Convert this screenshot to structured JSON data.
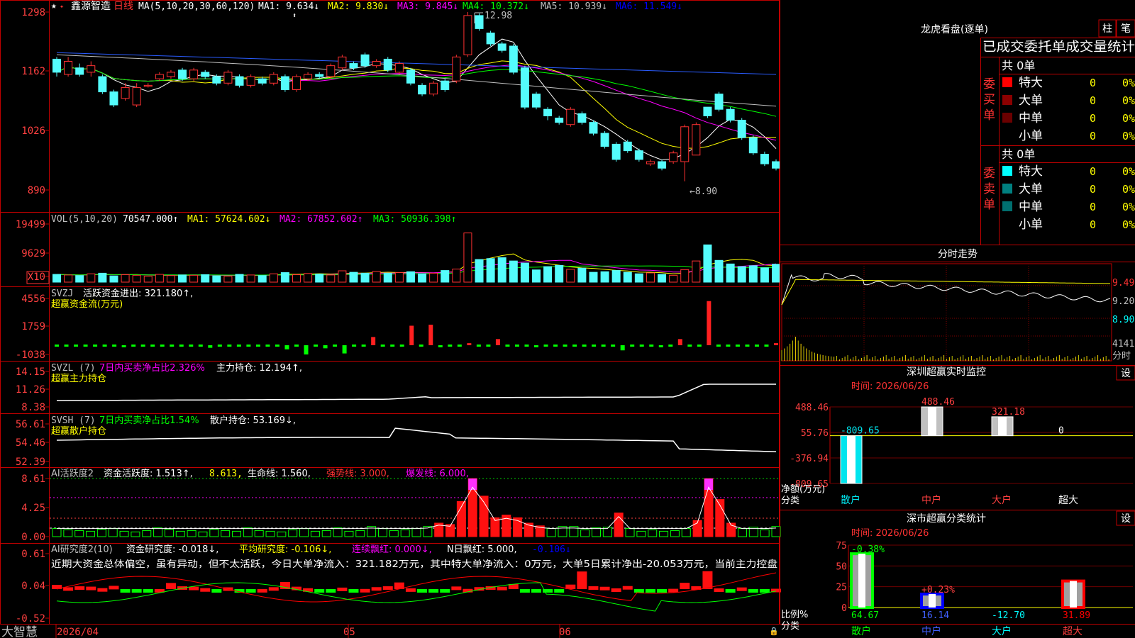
{
  "stock": {
    "name": "鑫源智造",
    "period": "日线",
    "star_icon": "star-icon"
  },
  "candles": {
    "ma_label": "MA(5,10,20,30,60,120)",
    "ma1": "MA1: 9.634↓",
    "ma2": "MA2: 9.830↓",
    "ma3": "MA3: 9.845↓",
    "ma4": "MA4: 10.372↓",
    "ma5": "MA5: 10.939↓",
    "ma6": "MA6: 11.549↓",
    "yticks": [
      "1298",
      "1162",
      "1026",
      "890"
    ],
    "high_label": "12.98",
    "low_label": "←8.90",
    "open": [
      11.9,
      11.55,
      11.7,
      11.6,
      11.5,
      11.15,
      11.0,
      10.85,
      11.3,
      11.45,
      11.5,
      11.65,
      11.45,
      11.6,
      11.5,
      11.35,
      11.5,
      11.3,
      11.45,
      11.35,
      11.5,
      11.2,
      11.45,
      11.55,
      11.5,
      11.7,
      11.8,
      12.0,
      11.75,
      11.9,
      11.6,
      11.65,
      11.3,
      11.1,
      11.4,
      11.4,
      12.0,
      12.9,
      12.5,
      12.25,
      12.2,
      11.7,
      11.1,
      10.75,
      10.55,
      10.4,
      10.65,
      10.45,
      10.2,
      9.95,
      10.0,
      9.8,
      9.5,
      9.55,
      9.55,
      9.55,
      9.7,
      10.8,
      11.1,
      10.75,
      10.5,
      10.1,
      9.72,
      9.55
    ],
    "close": [
      11.6,
      11.85,
      11.55,
      11.75,
      11.15,
      10.85,
      11.25,
      11.25,
      11.3,
      11.55,
      11.6,
      11.45,
      11.65,
      11.5,
      11.35,
      11.6,
      11.3,
      11.5,
      11.35,
      11.55,
      11.2,
      11.5,
      11.55,
      11.5,
      11.75,
      11.95,
      11.7,
      11.75,
      11.85,
      11.65,
      11.8,
      11.35,
      11.1,
      11.35,
      11.2,
      11.95,
      12.9,
      12.6,
      12.25,
      12.1,
      11.6,
      10.8,
      10.8,
      10.6,
      10.45,
      10.75,
      10.45,
      10.2,
      9.9,
      9.6,
      9.8,
      9.6,
      9.55,
      9.4,
      9.75,
      10.35,
      10.4,
      10.6,
      10.75,
      10.5,
      10.1,
      9.75,
      9.5,
      9.4
    ],
    "high": [
      11.95,
      11.95,
      11.8,
      11.85,
      11.55,
      11.2,
      11.35,
      11.35,
      11.35,
      11.6,
      11.65,
      11.7,
      11.7,
      11.65,
      11.55,
      11.65,
      11.55,
      11.55,
      11.5,
      11.6,
      11.55,
      11.55,
      11.6,
      11.6,
      11.8,
      12.0,
      11.85,
      12.05,
      11.9,
      11.95,
      11.85,
      11.7,
      11.35,
      11.4,
      11.45,
      12.0,
      12.98,
      12.95,
      12.55,
      12.3,
      12.25,
      11.75,
      11.15,
      10.8,
      10.6,
      10.8,
      10.7,
      10.5,
      10.25,
      10.0,
      10.05,
      9.85,
      9.6,
      9.6,
      9.8,
      10.4,
      10.45,
      10.8,
      11.15,
      10.8,
      10.55,
      10.15,
      9.78,
      9.6
    ],
    "low": [
      11.5,
      11.5,
      11.5,
      11.5,
      11.1,
      10.8,
      10.95,
      10.8,
      11.25,
      11.4,
      11.45,
      11.4,
      11.4,
      11.45,
      11.3,
      11.3,
      11.25,
      11.25,
      11.3,
      11.3,
      11.15,
      11.15,
      11.4,
      11.45,
      11.45,
      11.65,
      11.65,
      11.7,
      11.7,
      11.6,
      11.55,
      11.3,
      11.05,
      11.05,
      11.15,
      11.35,
      11.95,
      12.55,
      12.2,
      12.05,
      11.55,
      10.75,
      10.75,
      10.5,
      10.4,
      10.35,
      10.4,
      10.15,
      9.85,
      9.55,
      9.75,
      9.55,
      9.45,
      9.35,
      9.5,
      9.1,
      10.35,
      10.55,
      10.7,
      10.45,
      10.05,
      9.7,
      9.45,
      9.35
    ]
  },
  "volume": {
    "label": "VOL(5,10,20)",
    "value": "70547.000↑",
    "ma1": "MA1: 57624.602↓",
    "ma2": "MA2: 67852.602↑",
    "ma3": "MA3: 50936.398↑",
    "yticks": [
      "19499",
      "9629",
      "X10"
    ],
    "values": [
      2.6,
      2.4,
      2.2,
      2.8,
      3.0,
      2.1,
      2.5,
      2.3,
      2.0,
      2.6,
      2.2,
      2.4,
      2.3,
      2.5,
      2.1,
      2.0,
      2.6,
      2.4,
      2.2,
      2.8,
      3.2,
      2.5,
      2.9,
      2.7,
      2.4,
      3.8,
      3.3,
      3.0,
      3.6,
      3.0,
      3.2,
      3.5,
      2.8,
      3.0,
      3.9,
      4.4,
      16.5,
      7.6,
      7.9,
      8.2,
      7.1,
      6.4,
      4.1,
      5.2,
      5.6,
      4.3,
      4.7,
      3.3,
      3.5,
      3.9,
      3.3,
      2.8,
      3.1,
      2.6,
      2.3,
      4.2,
      7.1,
      12.5,
      7.3,
      6.1,
      5.2,
      5.5,
      4.8,
      6.0
    ]
  },
  "svzj": {
    "label": "SVZJ",
    "title": "活跃资金进出: 321.180↑,",
    "subtitle": "超赢资金流(万元)",
    "yticks": [
      "4556",
      "1759",
      "-1038"
    ],
    "values": [
      0,
      0,
      0,
      0,
      0,
      0,
      0,
      -200,
      0,
      0,
      0,
      0,
      0,
      0,
      0,
      0,
      -250,
      0,
      0,
      0,
      0,
      0,
      0,
      0,
      -400,
      0,
      -900,
      0,
      -300,
      0,
      -800,
      0,
      0,
      800,
      0,
      0,
      0,
      1900,
      0,
      2000,
      -200,
      0,
      0,
      200,
      0,
      0,
      600,
      0,
      0,
      0,
      -200,
      0,
      0,
      0,
      0,
      0,
      0,
      0,
      0,
      -500,
      0,
      0,
      0,
      -200,
      0,
      600,
      0,
      0,
      4300,
      0,
      0,
      0,
      0,
      0,
      0,
      200
    ]
  },
  "svzl": {
    "label": "SVZL (7)",
    "title": "7日内买卖净占比2.326%",
    "hold": "主力持仓: 12.194↑,",
    "subtitle": "超赢主力持仓",
    "yticks": [
      "14.15",
      "11.26",
      "8.38"
    ]
  },
  "svsh": {
    "label": "SVSH (7)",
    "title": "7日内买卖净占比1.54%",
    "hold": "散户持仓: 53.169↓,",
    "subtitle": "超赢散户持仓",
    "yticks": [
      "56.61",
      "54.46",
      "52.39"
    ]
  },
  "ai_active": {
    "label": "AI活跃度2",
    "active": "资金活跃度: 1.513↑,",
    "val2": "8.613,",
    "life": "生命线: 1.560,",
    "strong": "强势线: 3.000,",
    "burst": "爆发线: 6.000,",
    "yticks": [
      "8.61",
      "4.25",
      "0.00"
    ],
    "values": [
      1.2,
      1.0,
      0.9,
      0.8,
      1.1,
      1.2,
      0.8,
      0.7,
      0.9,
      1.3,
      1.1,
      0.8,
      0.9,
      0.7,
      1.1,
      0.9,
      0.8,
      1.3,
      0.9,
      0.8,
      0.7,
      1.0,
      1.2,
      0.8,
      0.9,
      1.3,
      0.8,
      0.9,
      1.5,
      1.2,
      0.9,
      1.0,
      1.2,
      1.5,
      2.0,
      1.8,
      5.2,
      8.6,
      6.0,
      2.8,
      3.2,
      2.8,
      2.0,
      1.6,
      1.2,
      1.5,
      1.5,
      1.0,
      1.3,
      1.4,
      3.5,
      1.2,
      0.8,
      1.0,
      0.8,
      0.9,
      1.2,
      2.4,
      8.6,
      5.5,
      2.0,
      1.2,
      1.4,
      1.0,
      1.5
    ]
  },
  "ai_research": {
    "label": "AI研究度2(10)",
    "research": "资金研究度: -0.018↓,",
    "avg": "平均研究度: -0.106↓,",
    "streak": "连续飘红: 0.000↓,",
    "nday": "N日飘红: 5.000,",
    "nday2": "-0.106↓",
    "comment": "近期大资金总体偏空，虽有异动，但不太活跃，今日大单净流入：321.182万元，其中特大单净流入：0万元，大单5日累计净出-20.053万元，当前主力控盘",
    "yticks": [
      "0.61",
      "0.04",
      "-0.52"
    ]
  },
  "xaxis": {
    "labels": [
      "2026/04",
      "05",
      "06"
    ],
    "brand": "大智慧"
  },
  "panel_lhb": {
    "title": "龙虎看盘(逐单)",
    "btn1": "柱",
    "btn2": "笔",
    "subtitle": "已成交委托单成交量统计",
    "buy_side": "委买单",
    "sell_side": "委卖单",
    "buy_total": "共 0单",
    "sell_total": "共 0单",
    "rows_buy": [
      {
        "name": "特大",
        "value": "0",
        "pct": "0%",
        "color": "#ff0000"
      },
      {
        "name": "大单",
        "value": "0",
        "pct": "0%",
        "color": "#8b0000"
      },
      {
        "name": "中单",
        "value": "0",
        "pct": "0%",
        "color": "#6b0000"
      },
      {
        "name": "小单",
        "value": "0",
        "pct": "0%",
        "color": ""
      }
    ],
    "rows_sell": [
      {
        "name": "特大",
        "value": "0",
        "pct": "0%",
        "color": "#00ffff"
      },
      {
        "name": "大单",
        "value": "0",
        "pct": "0%",
        "color": "#008080"
      },
      {
        "name": "中单",
        "value": "0",
        "pct": "0%",
        "color": "#006f6f"
      },
      {
        "name": "小单",
        "value": "0",
        "pct": "0%",
        "color": ""
      }
    ]
  },
  "panel_intraday": {
    "title": "分时走势",
    "yticks": [
      "9.49",
      "9.20",
      "8.90"
    ],
    "vol_label": "4141",
    "vol_unit": "分时"
  },
  "panel_sz_monitor": {
    "title": "深圳超赢实时监控",
    "btn": "设",
    "time": "时间: 2026/06/26",
    "yticks": [
      "488.46",
      "55.76",
      "-376.94",
      "-809.65"
    ],
    "bars": [
      {
        "cat": "散户",
        "value": -809.65,
        "label": "-809.65"
      },
      {
        "cat": "中户",
        "value": 488.46,
        "label": "488.46"
      },
      {
        "cat": "大户",
        "value": 321.18,
        "label": "321.18"
      },
      {
        "cat": "超大",
        "value": 0,
        "label": "0"
      }
    ],
    "axis_label": "净额(万元)",
    "cat_label": "分类"
  },
  "panel_sz_class": {
    "title": "深市超赢分类统计",
    "btn": "设",
    "time": "时间: 2026/06/26",
    "yticks": [
      "75",
      "50",
      "25",
      "0"
    ],
    "bars": [
      {
        "cat": "散户",
        "value": 64.67,
        "label": "64.67",
        "delta": "-0.38%"
      },
      {
        "cat": "中户",
        "value": 16.14,
        "label": "16.14",
        "delta": "+0.23%"
      },
      {
        "cat": "大户",
        "value": -12.7,
        "label": "-12.70",
        "delta": ""
      },
      {
        "cat": "超大",
        "value": 31.89,
        "label": "31.89",
        "delta": ""
      }
    ],
    "axis_label": "比例%",
    "cat_label": "分类"
  }
}
